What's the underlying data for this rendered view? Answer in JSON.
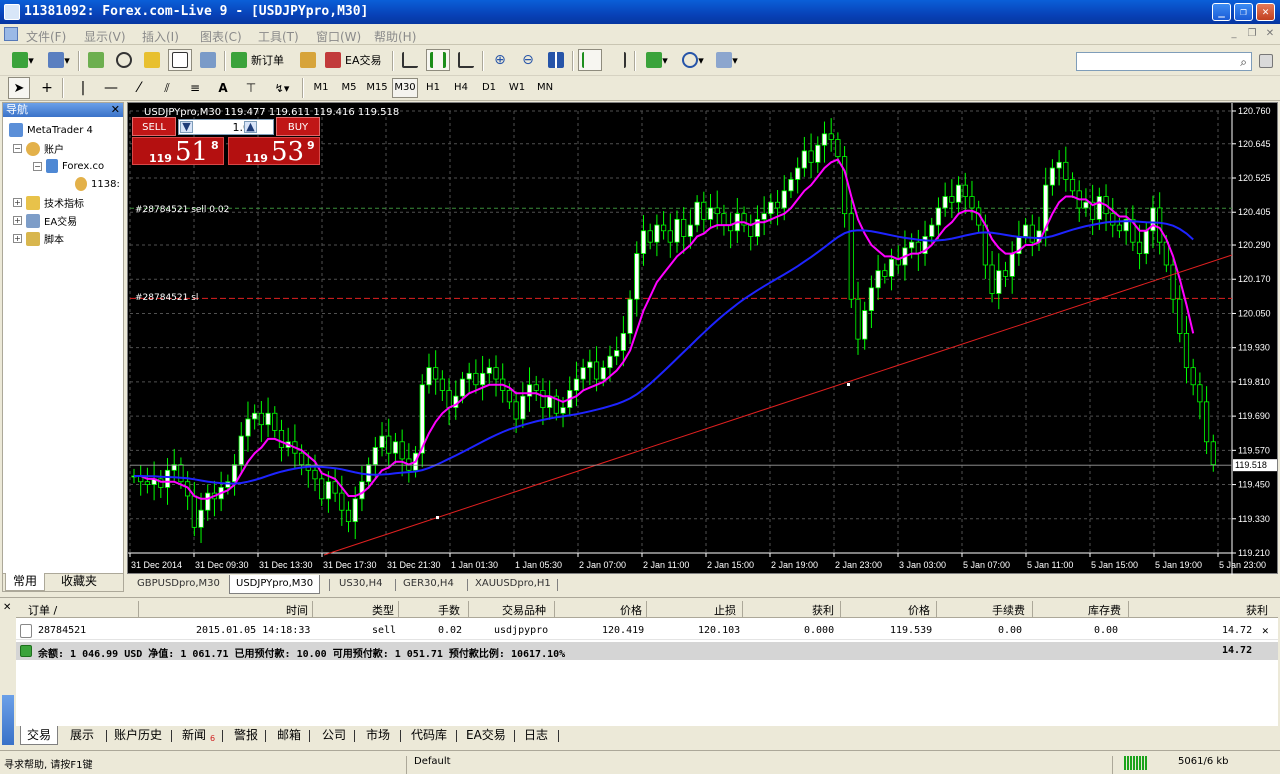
{
  "window": {
    "title": "11381092: Forex.com-Live 9 - [USDJPYpro,M30]"
  },
  "menu": [
    "文件(F)",
    "显示(V)",
    "插入(I)",
    "图表(C)",
    "工具(T)",
    "窗口(W)",
    "帮助(H)"
  ],
  "toolbar": {
    "new_order": "新订单",
    "ea_trading": "EA交易",
    "search_placeholder": ""
  },
  "timeframes": [
    "M1",
    "M5",
    "M15",
    "M30",
    "H1",
    "H4",
    "D1",
    "W1",
    "MN"
  ],
  "drawing_tools": {
    "text_tool": "A"
  },
  "navigator": {
    "title": "导航",
    "items": [
      "MetaTrader 4",
      "账户",
      "Forex.co",
      "1138:",
      "技术指标",
      "EA交易",
      "脚本"
    ],
    "tabs": [
      "常用",
      "收藏夹"
    ]
  },
  "chart": {
    "header": "USDJPYpro,M30  119.477 119.611 119.416 119.518",
    "order_label": "#28784521 sell 0.02",
    "sl_label": "#28784521 sl",
    "current_price": "119.518"
  },
  "one_click": {
    "sell": "SELL",
    "buy": "BUY",
    "lot": "1.00",
    "bid_prefix": "119",
    "bid_big": "51",
    "bid_sup": "8",
    "ask_prefix": "119",
    "ask_big": "53",
    "ask_sup": "9"
  },
  "chart_tabs": [
    "GBPUSDpro,M30",
    "USDJPYpro,M30",
    "US30,H4",
    "GER30,H4",
    "XAUUSDpro,H1"
  ],
  "chart_data": {
    "type": "line",
    "symbol": "USDJPYpro",
    "timeframe": "M30",
    "y_ticks": [
      "120.760",
      "120.645",
      "120.525",
      "120.405",
      "120.290",
      "120.170",
      "120.050",
      "119.930",
      "119.810",
      "119.690",
      "119.570",
      "119.450",
      "119.330",
      "119.210"
    ],
    "x_ticks": [
      "31 Dec 2014",
      "31 Dec 09:30",
      "31 Dec 13:30",
      "31 Dec 17:30",
      "31 Dec 21:30",
      "1 Jan 01:30",
      "1 Jan 05:30",
      "2 Jan 07:00",
      "2 Jan 11:00",
      "2 Jan 15:00",
      "2 Jan 19:00",
      "2 Jan 23:00",
      "3 Jan 03:00",
      "5 Jan 07:00",
      "5 Jan 11:00",
      "5 Jan 15:00",
      "5 Jan 19:00",
      "5 Jan 23:00"
    ],
    "ylim": [
      119.21,
      120.76
    ],
    "order_price": 120.419,
    "stop_loss": 120.103,
    "close": [
      119.48,
      119.46,
      119.45,
      119.47,
      119.44,
      119.5,
      119.52,
      119.46,
      119.41,
      119.3,
      119.36,
      119.42,
      119.4,
      119.44,
      119.46,
      119.52,
      119.62,
      119.68,
      119.7,
      119.66,
      119.7,
      119.64,
      119.58,
      119.6,
      119.56,
      119.52,
      119.5,
      119.47,
      119.4,
      119.46,
      119.42,
      119.36,
      119.32,
      119.4,
      119.46,
      119.52,
      119.58,
      119.62,
      119.56,
      119.6,
      119.54,
      119.5,
      119.56,
      119.8,
      119.86,
      119.82,
      119.78,
      119.72,
      119.76,
      119.82,
      119.84,
      119.8,
      119.84,
      119.86,
      119.82,
      119.78,
      119.74,
      119.68,
      119.76,
      119.8,
      119.78,
      119.72,
      119.76,
      119.7,
      119.72,
      119.78,
      119.82,
      119.86,
      119.88,
      119.82,
      119.86,
      119.9,
      119.92,
      119.98,
      120.1,
      120.26,
      120.34,
      120.3,
      120.36,
      120.34,
      120.3,
      120.38,
      120.32,
      120.36,
      120.44,
      120.38,
      120.42,
      120.4,
      120.36,
      120.34,
      120.4,
      120.36,
      120.32,
      120.38,
      120.4,
      120.44,
      120.42,
      120.48,
      120.52,
      120.56,
      120.62,
      120.58,
      120.64,
      120.68,
      120.66,
      120.6,
      120.4,
      120.1,
      119.96,
      120.06,
      120.14,
      120.2,
      120.18,
      120.24,
      120.22,
      120.28,
      120.3,
      120.26,
      120.32,
      120.36,
      120.42,
      120.46,
      120.44,
      120.5,
      120.46,
      120.42,
      120.36,
      120.22,
      120.12,
      120.2,
      120.18,
      120.26,
      120.32,
      120.36,
      120.3,
      120.34,
      120.5,
      120.56,
      120.58,
      120.52,
      120.48,
      120.42,
      120.44,
      120.38,
      120.46,
      120.4,
      120.36,
      120.34,
      120.38,
      120.3,
      120.26,
      120.34,
      120.42,
      120.3,
      120.22,
      120.1,
      119.98,
      119.86,
      119.8,
      119.74,
      119.6,
      119.52
    ],
    "ma_fast": [
      119.48,
      119.48,
      119.47,
      119.47,
      119.46,
      119.46,
      119.46,
      119.45,
      119.44,
      119.41,
      119.4,
      119.4,
      119.41,
      119.42,
      119.43,
      119.45,
      119.49,
      119.53,
      119.56,
      119.58,
      119.61,
      119.61,
      119.6,
      119.59,
      119.58,
      119.57,
      119.55,
      119.53,
      119.49,
      119.48,
      119.47,
      119.44,
      119.41,
      119.41,
      119.42,
      119.44,
      119.47,
      119.5,
      119.51,
      119.53,
      119.53,
      119.52,
      119.53,
      119.58,
      119.63,
      119.67,
      119.7,
      119.72,
      119.73,
      119.75,
      119.77,
      119.78,
      119.79,
      119.8,
      119.8,
      119.8,
      119.79,
      119.77,
      119.77,
      119.77,
      119.77,
      119.76,
      119.76,
      119.75,
      119.74,
      119.75,
      119.76,
      119.78,
      119.79,
      119.8,
      119.81,
      119.83,
      119.85,
      119.88,
      119.92,
      119.99,
      120.06,
      120.11,
      120.16,
      120.19,
      120.22,
      120.25,
      120.27,
      120.29,
      120.32,
      120.33,
      120.35,
      120.36,
      120.36,
      120.36,
      120.37,
      120.37,
      120.36,
      120.37,
      120.37,
      120.38,
      120.39,
      120.4,
      120.42,
      120.45,
      120.48,
      120.5,
      120.53,
      120.56,
      120.58,
      120.59,
      120.55,
      120.46,
      120.38,
      120.33,
      120.29,
      120.27,
      120.25,
      120.25,
      120.24,
      120.25,
      120.26,
      120.26,
      120.27,
      120.29,
      120.32,
      120.35,
      120.37,
      120.4,
      120.41,
      120.41,
      120.4,
      120.36,
      120.31,
      120.28,
      120.26,
      120.26,
      120.27,
      120.29,
      120.29,
      120.3,
      120.35,
      120.4,
      120.44,
      120.46,
      120.46,
      120.45,
      120.45,
      120.43,
      120.44,
      120.43,
      120.41,
      120.39,
      120.39,
      120.37,
      120.34,
      120.34,
      120.36,
      120.35,
      120.31,
      120.25,
      120.17,
      120.08,
      119.98
    ]
  },
  "terminal": {
    "headers": [
      "订单 /",
      "时间",
      "类型",
      "手数",
      "交易品种",
      "价格",
      "止损",
      "获利",
      "价格",
      "手续费",
      "库存费",
      "获利"
    ],
    "order": [
      "28784521",
      "2015.01.05 14:18:33",
      "sell",
      "0.02",
      "usdjpypro",
      "120.419",
      "120.103",
      "0.000",
      "119.539",
      "0.00",
      "0.00",
      "14.72"
    ],
    "balance_text": "余额: 1 046.99 USD  净值: 1 061.71  已用预付款: 10.00  可用预付款: 1 051.71  预付款比例: 10617.10%",
    "balance_profit": "14.72",
    "tabs": [
      "交易",
      "展示",
      "账户历史",
      "新闻",
      "警报",
      "邮箱",
      "公司",
      "市场",
      "代码库",
      "EA交易",
      "日志"
    ],
    "news_badge": "6"
  },
  "status": {
    "help": "寻求帮助, 请按F1键",
    "profile": "Default",
    "traffic": "5061/6 kb"
  },
  "colors": {
    "sell": "#C01616",
    "ma_fast": "#FF00FF",
    "ma_slow": "#1E24FF",
    "trend": "#E02020",
    "bull": "#FFFFFF",
    "bear": "#000000",
    "wick": "#00FF00",
    "grid": "#505050"
  }
}
